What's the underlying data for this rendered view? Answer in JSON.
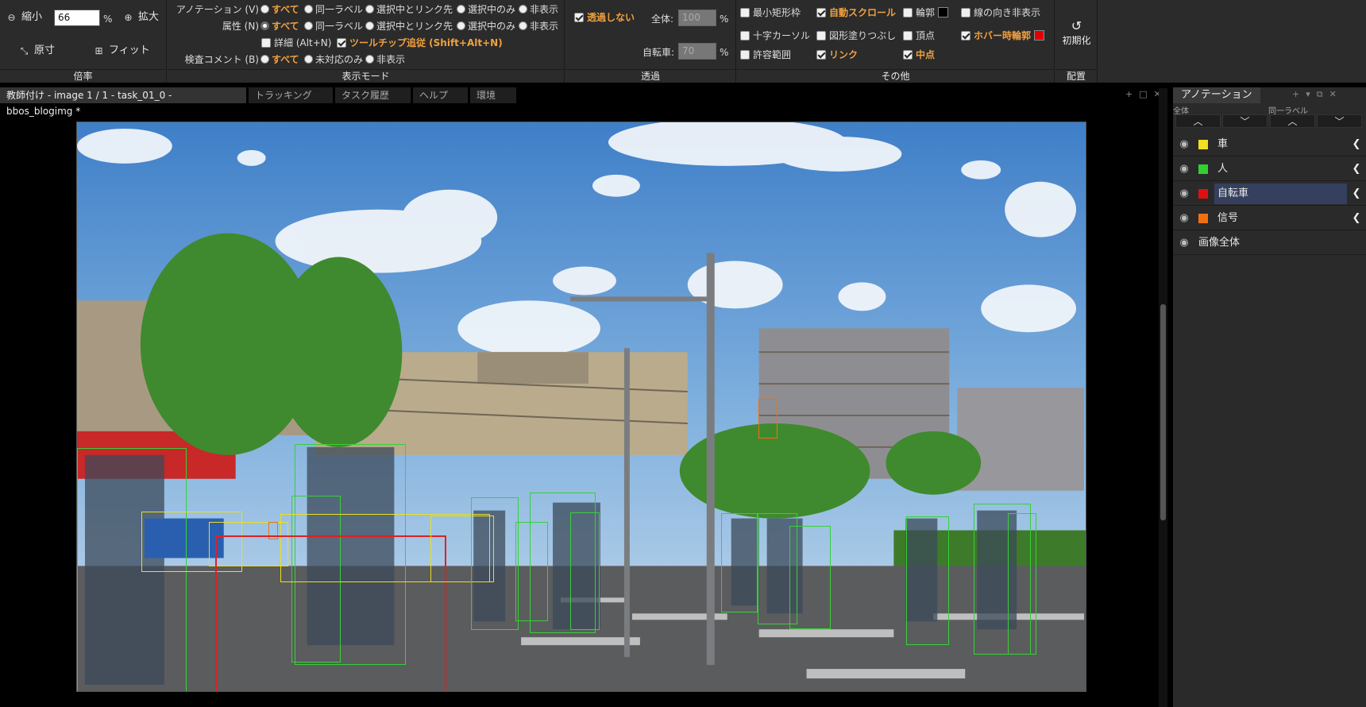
{
  "toolbar": {
    "zoom": {
      "zoom_out": "縮小",
      "value": "66",
      "unit": "%",
      "zoom_in": "拡大",
      "original": "原寸",
      "fit": "フィット",
      "footer": "倍率"
    },
    "display": {
      "annotation_label": "アノテーション (V)",
      "attribute_label": "属性 (N)",
      "review_label": "検査コメント (B)",
      "opt_all": "すべて",
      "opt_same": "同一ラベル",
      "opt_link": "選択中とリンク先",
      "opt_sel": "選択中のみ",
      "opt_hide": "非表示",
      "detail": "詳細 (Alt+N)",
      "tooltip": "ツールチップ追従 (Shift+Alt+N)",
      "unresolved": "未対応のみ",
      "footer": "表示モード"
    },
    "opacity": {
      "no_transparency": "透過しない",
      "all_label": "全体:",
      "all_value": "100",
      "bike_label": "自転車:",
      "bike_value": "70",
      "unit": "%",
      "footer": "透過"
    },
    "other": {
      "min_rect": "最小矩形枠",
      "auto_scroll": "自動スクロール",
      "outline": "輪郭",
      "hide_line_dir": "線の向き非表示",
      "cross_cursor": "十字カーソル",
      "fill_shape": "図形塗りつぶし",
      "vertex": "頂点",
      "hover_outline": "ホバー時輪郭",
      "tolerance": "許容範囲",
      "link": "リンク",
      "midpoint": "中点",
      "footer": "その他",
      "outline_color": "#000000",
      "hover_color": "#e00000"
    },
    "layout": {
      "reset": "初期化",
      "footer": "配置"
    }
  },
  "tabs": [
    {
      "label": "教師付け - image 1 / 1 - task_01_0 - bbos_blogimg *",
      "active": true
    },
    {
      "label": "トラッキング"
    },
    {
      "label": "タスク履歴"
    },
    {
      "label": "ヘルプ"
    },
    {
      "label": "環境"
    }
  ],
  "side": {
    "tab": "アノテーション",
    "hdr_all": "全体",
    "hdr_same": "同一ラベル",
    "rows": [
      {
        "label": "車",
        "color": "#f0e020"
      },
      {
        "label": "人",
        "color": "#30d030"
      },
      {
        "label": "自転車",
        "color": "#e01010",
        "selected": true
      },
      {
        "label": "信号",
        "color": "#f07010"
      },
      {
        "label": "画像全体"
      }
    ]
  }
}
